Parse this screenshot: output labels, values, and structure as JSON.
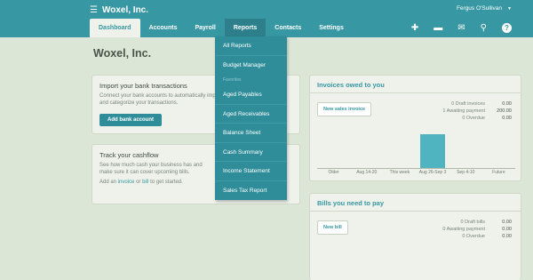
{
  "header": {
    "org_name": "Woxel, Inc.",
    "user_name": "Fergus O'Sullivan",
    "nav": [
      {
        "label": "Dashboard"
      },
      {
        "label": "Accounts"
      },
      {
        "label": "Payroll"
      },
      {
        "label": "Reports"
      },
      {
        "label": "Contacts"
      },
      {
        "label": "Settings"
      }
    ],
    "icons": [
      "plus-icon",
      "folder-icon",
      "mail-icon",
      "search-icon",
      "help-icon"
    ]
  },
  "page_title": "Woxel, Inc.",
  "import_card": {
    "title": "Import your bank transactions",
    "text": "Connect your bank accounts to automatically import and categorize your transactions.",
    "button": "Add bank account"
  },
  "track_card": {
    "title": "Track your cashflow",
    "text": "See how much cash your business has and make sure it can cover upcoming bills.",
    "add_prefix": "Add an",
    "invoice_link": "invoice",
    "or": "or",
    "bill_link": "bill",
    "add_suffix": "to get started."
  },
  "invoices": {
    "title": "Invoices owed to you",
    "button": "New sales invoice",
    "stats": [
      {
        "label": "0 Draft invoices",
        "value": "0.00"
      },
      {
        "label": "1 Awaiting payment",
        "value": "200.00"
      },
      {
        "label": "0 Overdue",
        "value": "0.00"
      }
    ],
    "chart_data": {
      "type": "bar",
      "categories": [
        "Older",
        "Aug 14-20",
        "This week",
        "Aug 26-Sep 3",
        "Sep 4-10",
        "Future"
      ],
      "values": [
        0,
        0,
        0,
        200,
        0,
        0
      ],
      "color": "#4fb3c0"
    }
  },
  "bills": {
    "title": "Bills you need to pay",
    "button": "New bill",
    "stats": [
      {
        "label": "0 Draft bills",
        "value": "0.00"
      },
      {
        "label": "0 Awaiting payment",
        "value": "0.00"
      },
      {
        "label": "0 Overdue",
        "value": "0.00"
      }
    ]
  },
  "reports_menu": {
    "items_top": [
      "All Reports",
      "Budget Manager"
    ],
    "section_label": "Favorites",
    "favorites": [
      "Aged Payables",
      "Aged Receivables",
      "Balance Sheet",
      "Cash Summary",
      "Income Statement",
      "Sales Tax Report"
    ]
  },
  "colors": {
    "brand": "#3797a3",
    "bar": "#4fb3c0",
    "page_bg": "#dce6d6"
  }
}
